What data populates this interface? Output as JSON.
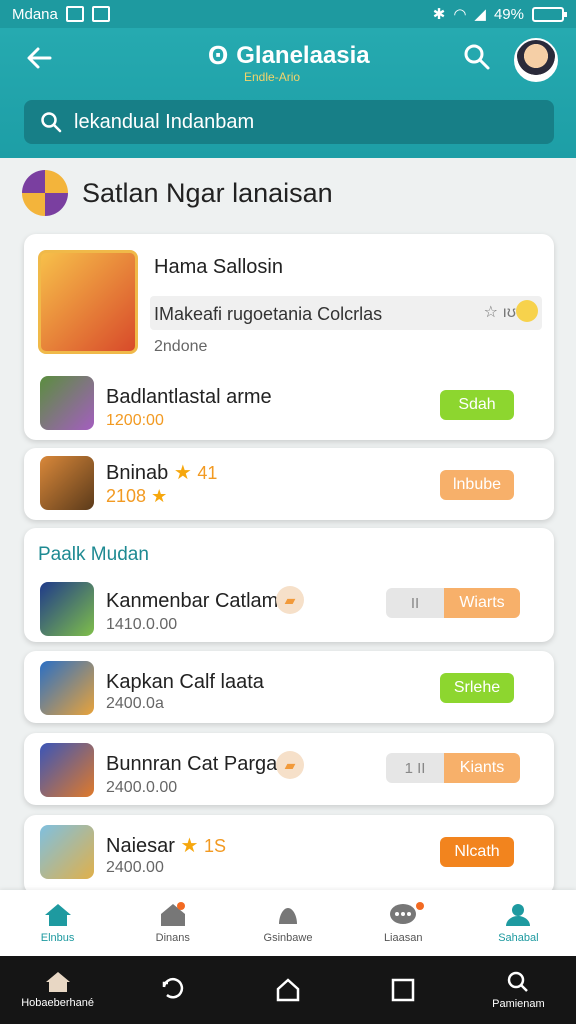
{
  "status": {
    "carrier": "Mdana",
    "battery": "49%"
  },
  "header": {
    "title": "Glanelaasia",
    "subtitle": "Endle-Ario",
    "search_placeholder": "lekandual Indanbam"
  },
  "section": {
    "title": "Satlan Ngar lanaisan"
  },
  "featured": {
    "title": "Hama Sallosin",
    "description": "IMakeafi rugoetania Colcrlas",
    "rating": "☆ ıʊ",
    "meta": "2ndone"
  },
  "items": [
    {
      "title": "Badlantlastal arme",
      "sub": "1200:00",
      "action": "Sdah"
    },
    {
      "title": "Bninab",
      "rating": "41",
      "sub": "2108",
      "action": "lnbube"
    }
  ],
  "section2": {
    "title": "Paalk Mudan"
  },
  "items2": [
    {
      "title": "Kanmenbar Catlam",
      "sub": "1410.0.00",
      "toggle_left": "II",
      "action": "Wiarts"
    },
    {
      "title": "Kapkan Calf laata",
      "sub": "2400.0a",
      "action": "Srlehe"
    },
    {
      "title": "Bunnran Cat Pargan",
      "sub": "2400.0.00",
      "toggle_left": "1 II",
      "action": "Kiants"
    },
    {
      "title": "Naiesar",
      "rating": "1S",
      "sub": "2400.00",
      "action": "Nlcath"
    }
  ],
  "bottom_nav": [
    "Elnbus",
    "Dinans",
    "Gsinbawe",
    "Liaasan",
    "Sahabal"
  ],
  "system_nav": {
    "home_label": "Hobaeberhané",
    "search_label": "Pamienam"
  },
  "colors": {
    "primary": "#1e9aa0",
    "green": "#8dd62f",
    "orange": "#f7b06a",
    "orange_strong": "#f2841e"
  }
}
